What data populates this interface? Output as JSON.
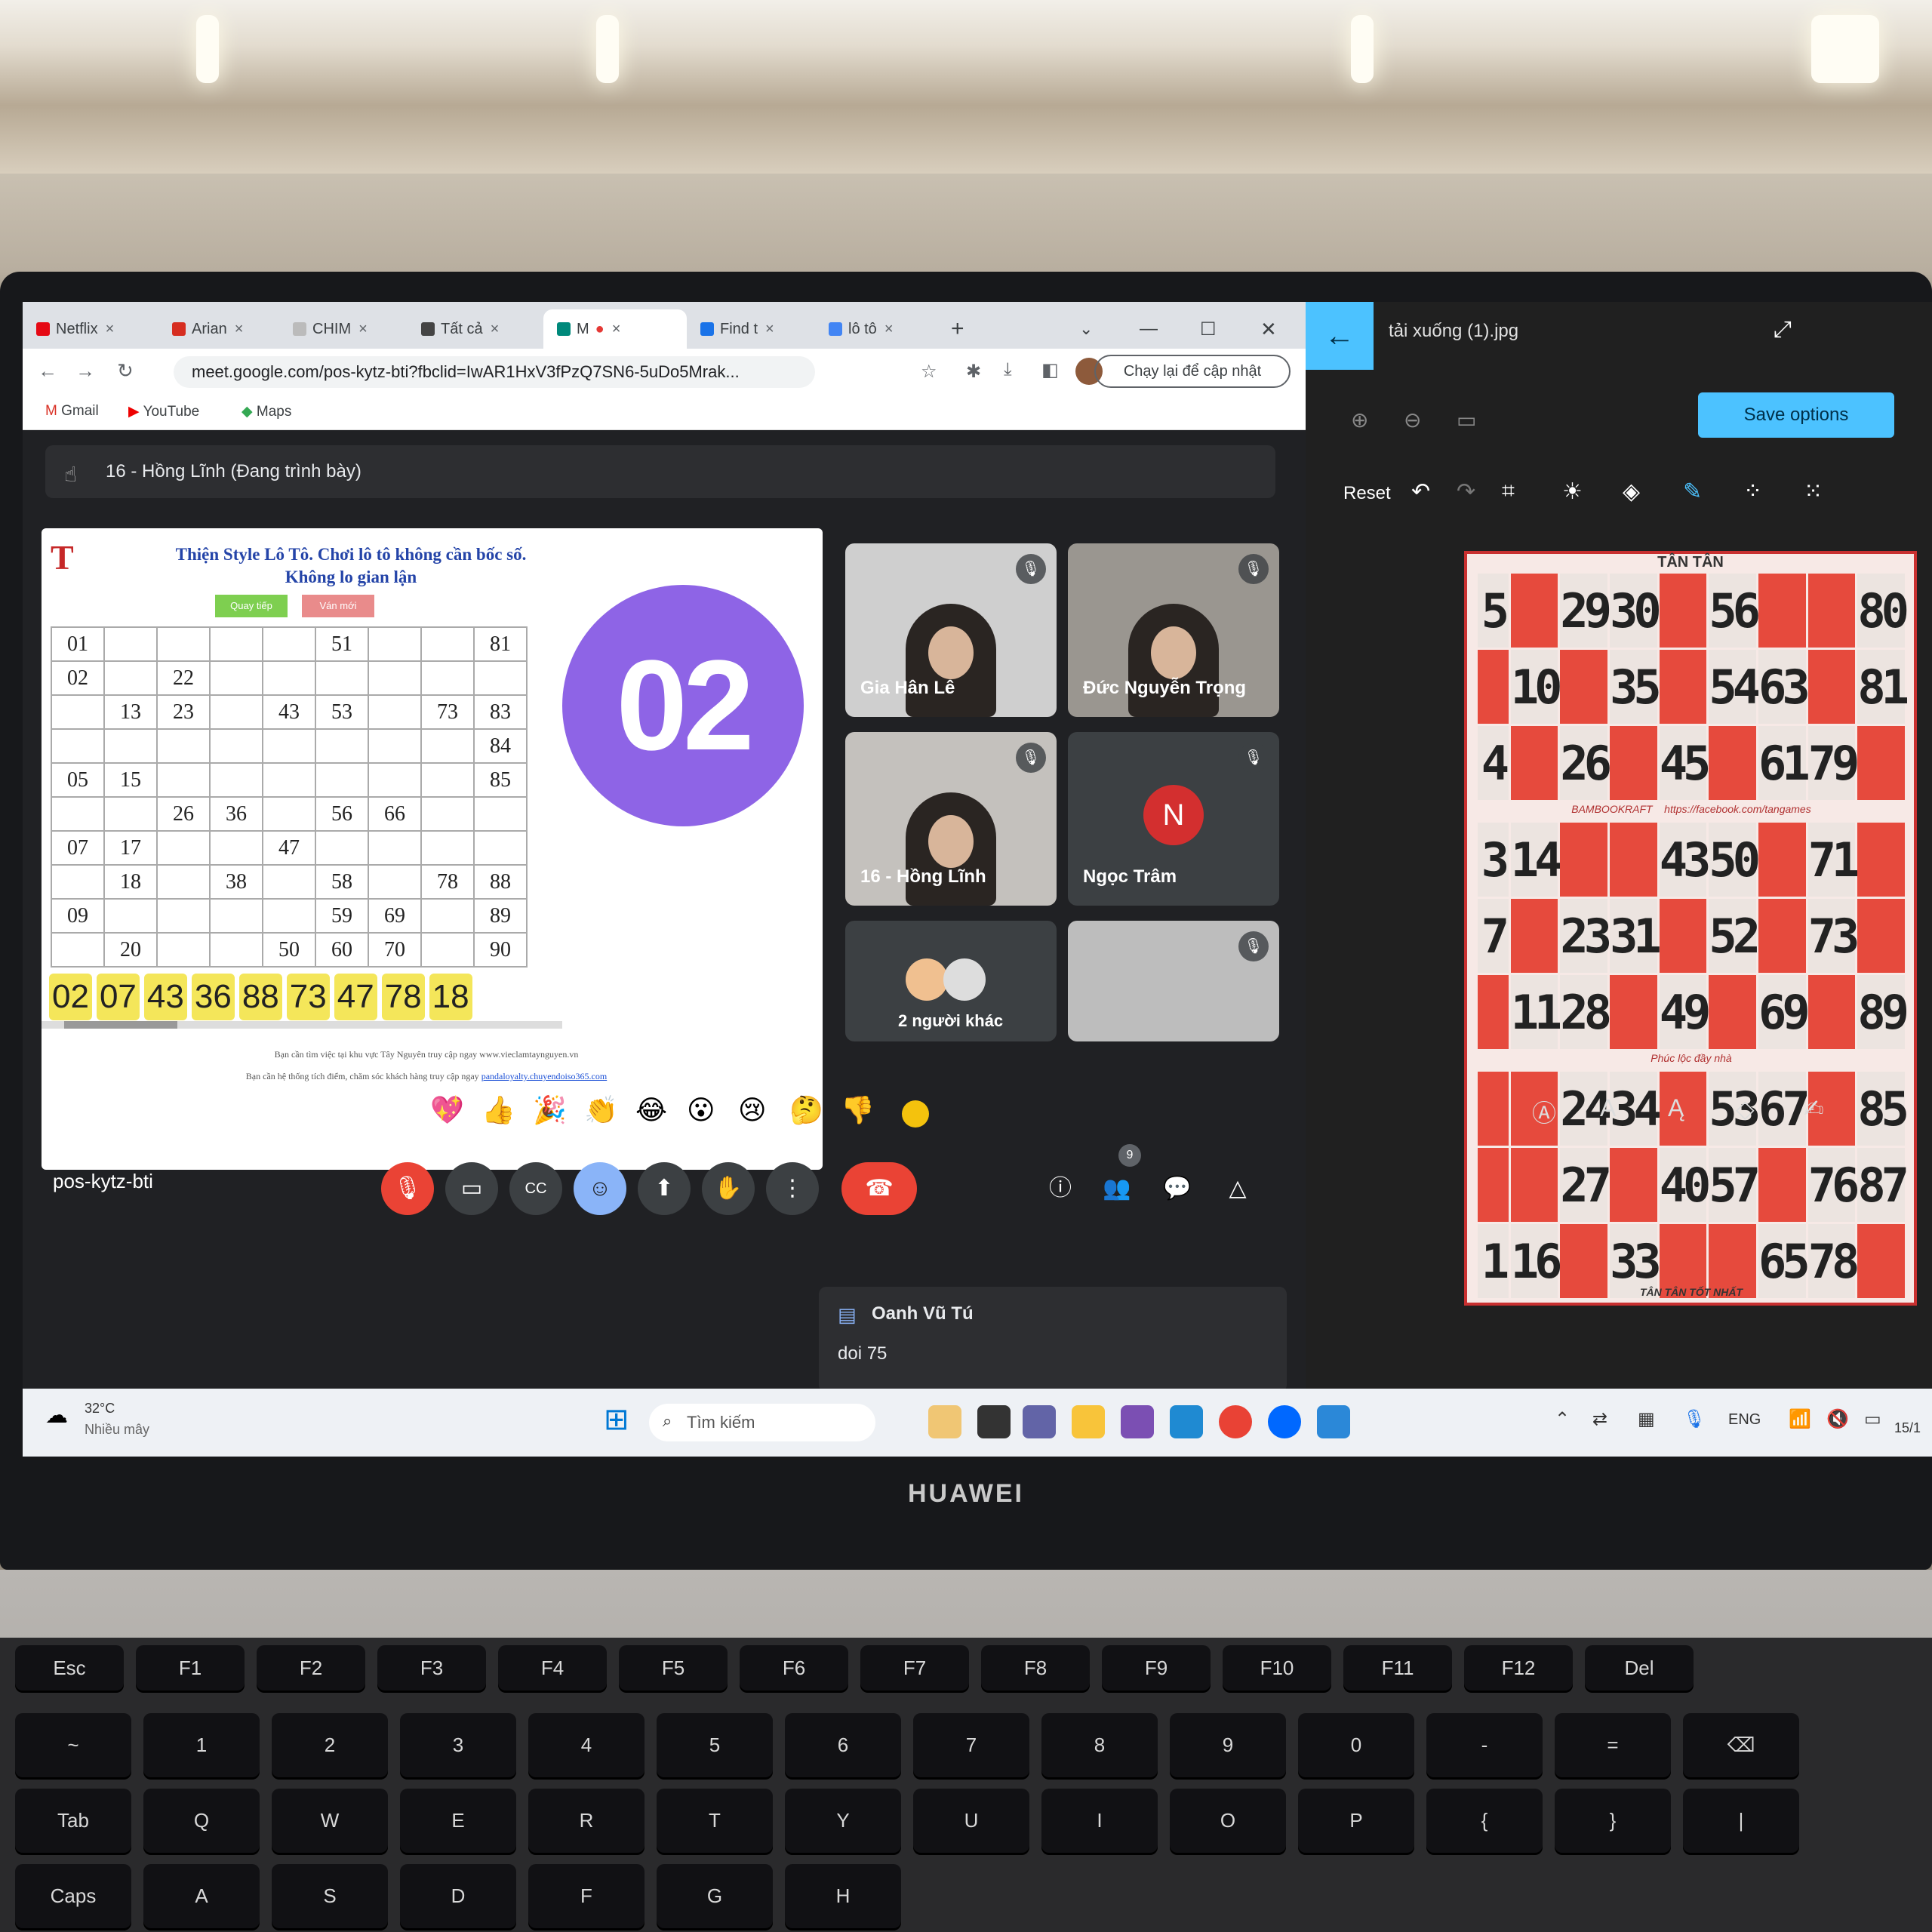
{
  "browser": {
    "tabs": [
      {
        "label": "Netflix"
      },
      {
        "label": "Arian"
      },
      {
        "label": "CHIM"
      },
      {
        "label": "Tất cả"
      },
      {
        "label": "M"
      },
      {
        "label": "Find t"
      },
      {
        "label": "lô tô"
      }
    ],
    "url": "meet.google.com/pos-kytz-bti?fbclid=IwAR1HxV3fPzQ7SN6-5uDo5Mrak...",
    "update_button": "Chạy lại để cập nhật",
    "bookmarks": [
      {
        "label": "Gmail"
      },
      {
        "label": "YouTube"
      },
      {
        "label": "Maps"
      }
    ]
  },
  "meet": {
    "presenter": "16 - Hồng Lĩnh (Đang trình bày)",
    "meeting_code": "pos-kytz-bti",
    "participants_badge": "9",
    "participants": [
      {
        "name": "Gia Hân Lê"
      },
      {
        "name": "Đức Nguyễn Trọng"
      },
      {
        "name": "16 - Hồng Lĩnh"
      },
      {
        "name": "Ngọc Trâm",
        "initial": "N"
      },
      {
        "name": "2 người khác"
      }
    ],
    "chat": {
      "sender": "Oanh Vũ Tú",
      "message": "doi 75"
    },
    "reactions": [
      "💖",
      "👍",
      "🎉",
      "👏",
      "😂",
      "😮",
      "😢",
      "🤔",
      "👎"
    ]
  },
  "slide": {
    "title_line1": "Thiện Style Lô Tô. Chơi lô tô không cần bốc số.",
    "title_line2": "Không lo gian lận",
    "btn_next": "Quay tiếp",
    "btn_new": "Ván mới",
    "current_number": "02",
    "grid": [
      [
        "01",
        "",
        "",
        "",
        "",
        "51",
        "",
        "",
        "81"
      ],
      [
        "02",
        "",
        "22",
        "",
        "",
        "",
        "",
        "",
        ""
      ],
      [
        "",
        "13",
        "23",
        "",
        "43",
        "53",
        "",
        "73",
        "83"
      ],
      [
        "",
        "",
        "",
        "",
        "",
        "",
        "",
        "",
        "84"
      ],
      [
        "05",
        "15",
        "",
        "",
        "",
        "",
        "",
        "",
        "85"
      ],
      [
        "",
        "",
        "26",
        "36",
        "",
        "56",
        "66",
        "",
        ""
      ],
      [
        "07",
        "17",
        "",
        "",
        "47",
        "",
        "",
        "",
        ""
      ],
      [
        "",
        "18",
        "",
        "38",
        "",
        "58",
        "",
        "78",
        "88"
      ],
      [
        "09",
        "",
        "",
        "",
        "",
        "59",
        "69",
        "",
        "89"
      ],
      [
        "",
        "20",
        "",
        "",
        "50",
        "60",
        "70",
        "",
        "90"
      ]
    ],
    "called_numbers": [
      "02",
      "07",
      "43",
      "36",
      "88",
      "73",
      "47",
      "78",
      "18"
    ],
    "footer_line1": "Bạn cần tìm việc tại khu vực Tây Nguyên truy cập ngay www.vieclamtaynguyen.vn",
    "footer_line2": "Bạn cần hệ thống tích điểm, chăm sóc khách hàng truy cập ngay",
    "footer_link2": "pandaloyalty.chuyendoiso365.com"
  },
  "photos": {
    "file_title": "tải xuống (1).jpg",
    "save_options": "Save options",
    "reset": "Reset",
    "ticket": {
      "header": "TÂN TÂN",
      "band1_left": "BAMBOOKRAFT",
      "band1_right": "https://facebook.com/tangames",
      "band2": "Phúc lộc đầy nhà",
      "footer": "TÂN TÂN TỐT NHẤT",
      "section1": [
        [
          "5",
          "",
          "29",
          "30",
          "",
          "56",
          "",
          "",
          "80"
        ],
        [
          "",
          "10",
          "",
          "35",
          "",
          "54",
          "63",
          "",
          "81"
        ],
        [
          "4",
          "",
          "26",
          "",
          "45",
          "",
          "61",
          "79",
          ""
        ]
      ],
      "section2": [
        [
          "3",
          "14",
          "",
          "",
          "43",
          "50",
          "",
          "71",
          ""
        ],
        [
          "7",
          "",
          "23",
          "31",
          "",
          "52",
          "",
          "73",
          ""
        ],
        [
          "",
          "11",
          "28",
          "",
          "49",
          "",
          "69",
          "",
          "89"
        ]
      ],
      "section3": [
        [
          "",
          "",
          "24",
          "34",
          "",
          "53",
          "67",
          "",
          "85"
        ],
        [
          "",
          "",
          "27",
          "",
          "40",
          "57",
          "",
          "76",
          "87"
        ],
        [
          "1",
          "16",
          "",
          "33",
          "",
          "",
          "65",
          "78",
          ""
        ]
      ]
    }
  },
  "taskbar": {
    "temperature": "32°C",
    "weather": "Nhiều mây",
    "search_placeholder": "Tìm kiếm",
    "language": "ENG",
    "date": "15/1"
  },
  "laptop": {
    "brand": "HUAWEI"
  },
  "keyboard": {
    "row0": [
      "Esc",
      "F1",
      "F2",
      "F3",
      "F4",
      "F5",
      "F6",
      "F7",
      "F8",
      "F9",
      "F10",
      "F11",
      "F12",
      "Del"
    ],
    "row1": [
      "~",
      "1",
      "2",
      "3",
      "4",
      "5",
      "6",
      "7",
      "8",
      "9",
      "0",
      "-",
      "=",
      "⌫"
    ],
    "row2": [
      "Tab",
      "Q",
      "W",
      "E",
      "R",
      "T",
      "Y",
      "U",
      "I",
      "O",
      "P",
      "{",
      "}",
      "|"
    ],
    "row3": [
      "Caps",
      "A",
      "S",
      "D",
      "F",
      "G",
      "H"
    ]
  }
}
